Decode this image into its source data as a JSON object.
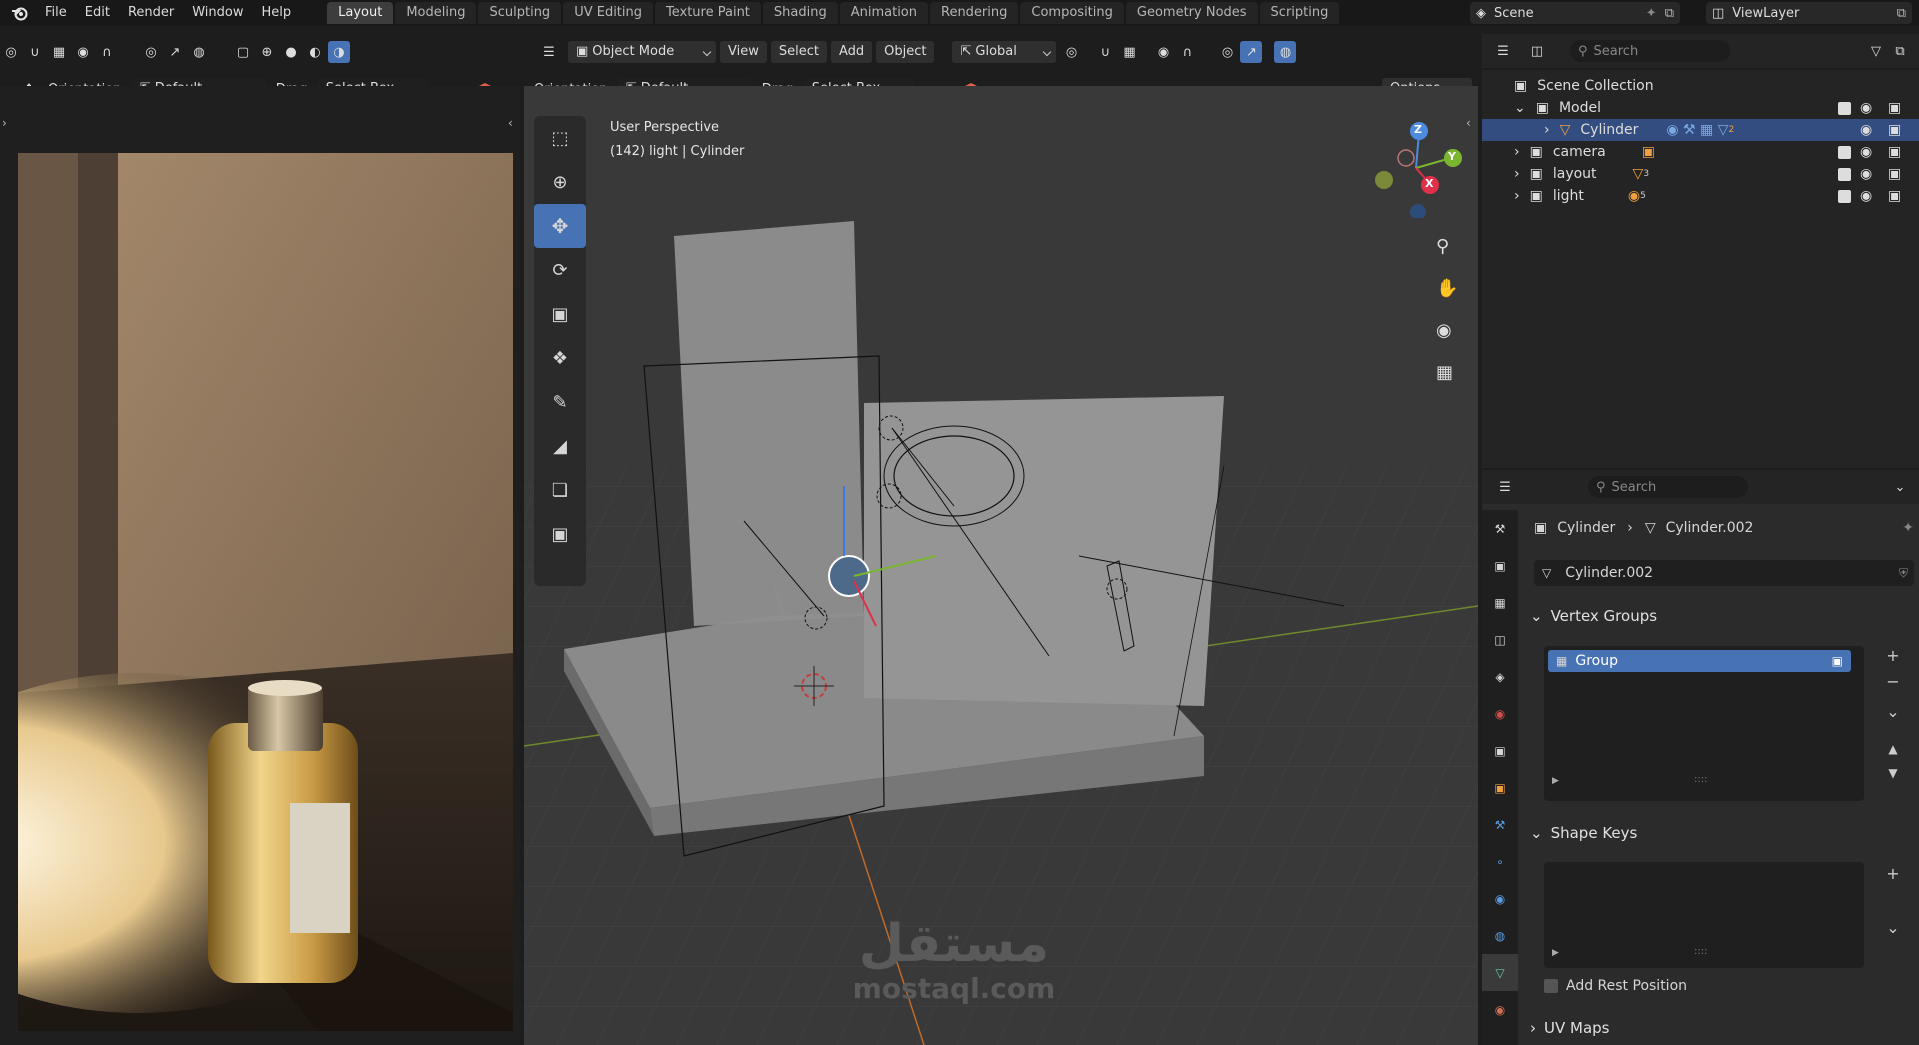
{
  "topbar": {
    "menus": [
      "File",
      "Edit",
      "Render",
      "Window",
      "Help"
    ],
    "workspace_tabs": [
      "Layout",
      "Modeling",
      "Sculpting",
      "UV Editing",
      "Texture Paint",
      "Shading",
      "Animation",
      "Rendering",
      "Compositing",
      "Geometry Nodes",
      "Scripting"
    ],
    "active_tab": "Layout",
    "scene": "Scene",
    "view_layer": "ViewLayer"
  },
  "left_header": {
    "orientation_label": "Orientation:",
    "orientation_value": "Default",
    "drag_label": "Drag:",
    "drag_value": "Select Box"
  },
  "viewport_header": {
    "mode": "Object Mode",
    "menus": [
      "View",
      "Select",
      "Add",
      "Object"
    ],
    "transform_orientation": "Global",
    "orientation_label": "Orientation:",
    "orientation_value": "Default",
    "drag_label": "Drag:",
    "drag_value": "Select Box",
    "options_label": "Options"
  },
  "viewport": {
    "view_name": "User Perspective",
    "frame_info": "(142) light | Cylinder",
    "gizmo_axes": [
      "Z",
      "Y",
      "X"
    ]
  },
  "outliner": {
    "search_placeholder": "Search",
    "root": "Scene Collection",
    "items": [
      {
        "name": "Model",
        "badge": ""
      },
      {
        "name": "Cylinder",
        "badge": "2"
      },
      {
        "name": "camera",
        "badge": ""
      },
      {
        "name": "layout",
        "badge": "3"
      },
      {
        "name": "light",
        "badge": "5"
      }
    ]
  },
  "properties": {
    "search_placeholder": "Search",
    "breadcrumb_object": "Cylinder",
    "breadcrumb_data": "Cylinder.002",
    "data_name": "Cylinder.002",
    "vertex_groups_title": "Vertex Groups",
    "vertex_group_item": "Group",
    "shape_keys_title": "Shape Keys",
    "rest_position_label": "Add Rest Position",
    "uv_maps_title": "UV Maps"
  },
  "watermark": {
    "arabic": "مستقل",
    "latin": "mostaql.com"
  }
}
